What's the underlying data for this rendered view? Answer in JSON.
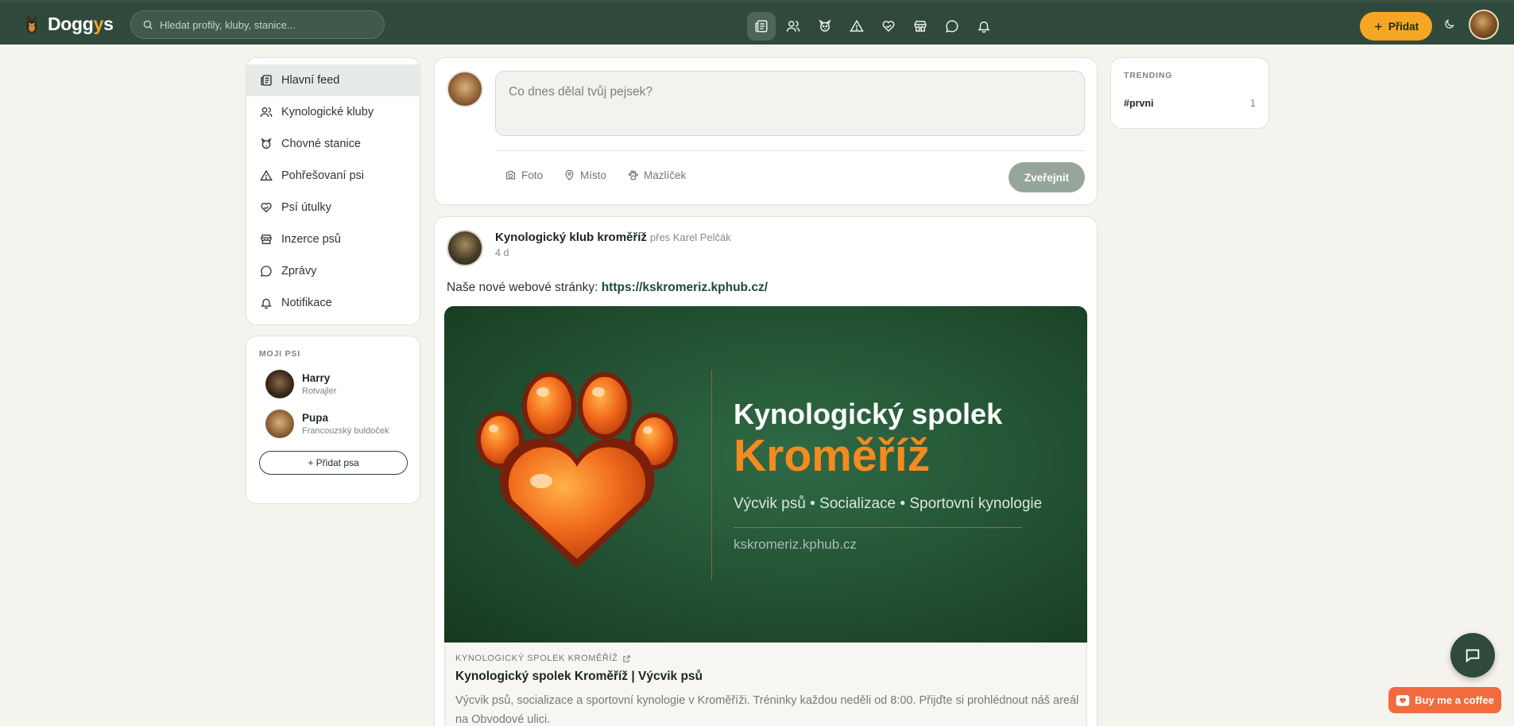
{
  "app": {
    "name_main": "Dogg",
    "name_accent": "y",
    "name_tail": "s"
  },
  "search": {
    "placeholder": "Hledat profily, kluby, stanice..."
  },
  "nav_icons": [
    "feed-icon",
    "clubs-icon",
    "kennels-icon",
    "missing-icon",
    "shelters-icon",
    "ads-icon",
    "messages-icon",
    "notifications-icon"
  ],
  "header": {
    "add_label": "Přidat"
  },
  "sidebar": {
    "items": [
      {
        "label": "Hlavní feed",
        "icon": "feed-icon",
        "active": true
      },
      {
        "label": "Kynologické kluby",
        "icon": "clubs-icon"
      },
      {
        "label": "Chovné stanice",
        "icon": "kennels-icon"
      },
      {
        "label": "Pohřešovaní psi",
        "icon": "missing-icon"
      },
      {
        "label": "Psí útulky",
        "icon": "shelters-icon"
      },
      {
        "label": "Inzerce psů",
        "icon": "ads-icon"
      },
      {
        "label": "Zprávy",
        "icon": "messages-icon"
      },
      {
        "label": "Notifikace",
        "icon": "notifications-icon"
      }
    ]
  },
  "my_dogs": {
    "title": "MOJI PSI",
    "dogs": [
      {
        "name": "Harry",
        "breed": "Rotvajler"
      },
      {
        "name": "Pupa",
        "breed": "Francouzský buldoček"
      }
    ],
    "add_label": "+ Přidat psa"
  },
  "composer": {
    "placeholder": "Co dnes dělal tvůj pejsek?",
    "tools": {
      "photo": "Foto",
      "place": "Místo",
      "pet": "Mazlíček"
    },
    "publish_label": "Zveřejnit"
  },
  "post": {
    "author": "Kynologický klub kroměříž",
    "via": "přes Karel Pelčák",
    "time": "4 d",
    "text": "Naše nové webové stránky: ",
    "link": "https://kskromeriz.kphub.cz/",
    "banner": {
      "title_line1": "Kynologický spolek",
      "title_line2": "Kroměříž",
      "tagline": "Výcvik psů • Socializace • Sportovní kynologie",
      "url": "kskromeriz.kphub.cz"
    },
    "preview": {
      "site": "KYNOLOGICKÝ SPOLEK KROMĚŘÍŽ",
      "title": "Kynologický spolek Kroměříž | Výcvik psů",
      "description": "Výcvik psů, socializace a sportovní kynologie v Kroměříži. Tréninky každou neděli od 8:00. Přijďte si prohlédnout náš areál na Obvodové ulici."
    }
  },
  "trending": {
    "title": "TRENDING",
    "items": [
      {
        "tag": "#prvni",
        "count": "1"
      }
    ]
  },
  "floating": {
    "coffee_label": "Buy me a coffee"
  },
  "colors": {
    "primary": "#2f4a3c",
    "accent": "#f5a623",
    "background": "#f5f3ee",
    "publish_disabled": "#96a59c",
    "coffee": "#f16b3f"
  }
}
